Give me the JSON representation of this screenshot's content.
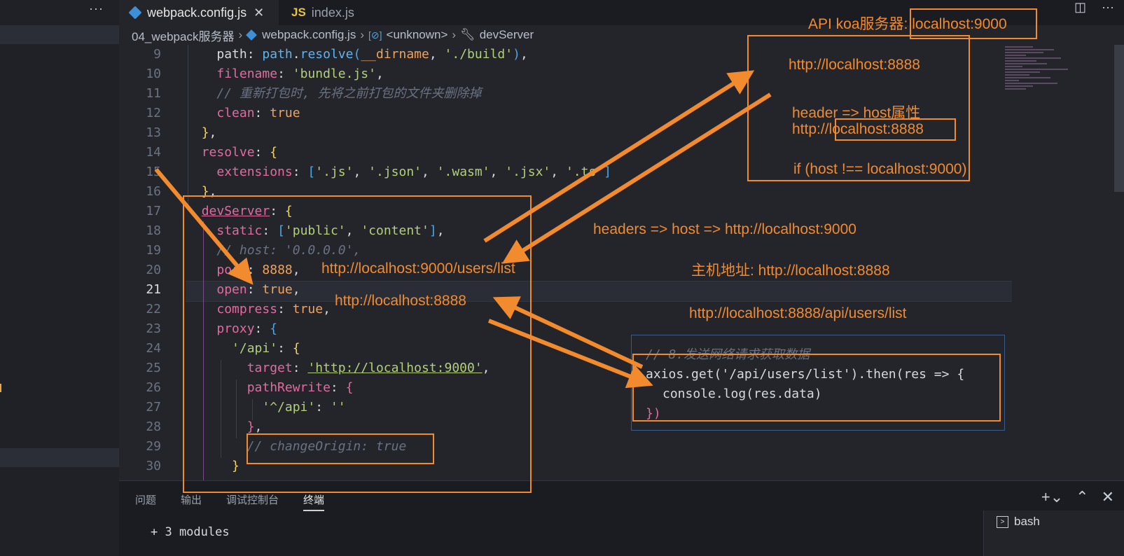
{
  "sidebar": {
    "more_label": "···"
  },
  "tabs": [
    {
      "label": "webpack.config.js",
      "icon": "webpack-icon",
      "active": true,
      "close": "✕"
    },
    {
      "label": "index.js",
      "icon": "js-icon",
      "active": false
    }
  ],
  "tab_js_glyph": "JS",
  "breadcrumb": {
    "folder": "04_webpack服务器",
    "file": "webpack.config.js",
    "symbol1": "<unknown>",
    "symbol2": "devServer"
  },
  "editor": {
    "current_line": "21",
    "line_numbers": [
      "9",
      "10",
      "11",
      "12",
      "13",
      "14",
      "15",
      "16",
      "17",
      "18",
      "19",
      "20",
      "21",
      "22",
      "23",
      "24",
      "25",
      "26",
      "27",
      "28",
      "29",
      "30"
    ]
  },
  "popup_code": {
    "comment": "// 8.发送网络请求获取数据",
    "line1": "axios.get('/api/users/list').then(res => {",
    "line2": "console.log(res.data)",
    "line3": "})"
  },
  "panel": {
    "tabs": [
      "问题",
      "输出",
      "调试控制台",
      "终端"
    ],
    "active_tab": "终端",
    "terminal_output": "+ 3 modules",
    "terminal_item": "bash"
  },
  "annotations": {
    "api_server": "API koa服务器: localhost:9000",
    "box_host_1": "http://localhost:8888",
    "box_header": "header => host属性",
    "box_host_2": "http://localhost:8888",
    "box_if": "if (host !== localhost:9000)",
    "headers_host": "headers => host => http://localhost:9000",
    "host_addr": "主机地址: http://localhost:8888",
    "api_url": "http://localhost:8888/api/users/list",
    "url_9000": "http://localhost:9000/users/list",
    "url_8888": "http://localhost:8888"
  },
  "colors": {
    "annotation": "#f28a2e",
    "keyword": "#e06c9f",
    "string": "#b3cf7a",
    "comment": "#6a7180"
  }
}
